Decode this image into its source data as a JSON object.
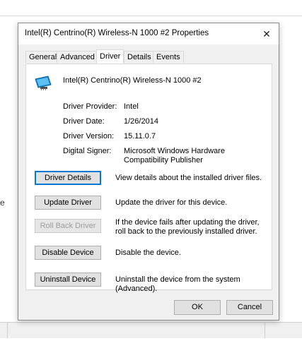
{
  "dialog": {
    "title": "Intel(R) Centrino(R) Wireless-N 1000 #2 Properties",
    "close_symbol": "✕"
  },
  "tabs": [
    {
      "label": "General"
    },
    {
      "label": "Advanced"
    },
    {
      "label": "Driver"
    },
    {
      "label": "Details"
    },
    {
      "label": "Events"
    }
  ],
  "active_tab": "Driver",
  "device": {
    "name": "Intel(R) Centrino(R) Wireless-N 1000 #2",
    "icon": "network-adapter-icon"
  },
  "properties": {
    "provider_label": "Driver Provider:",
    "provider_value": "Intel",
    "date_label": "Driver Date:",
    "date_value": "1/26/2014",
    "version_label": "Driver Version:",
    "version_value": "15.11.0.7",
    "signer_label": "Digital Signer:",
    "signer_value": "Microsoft Windows Hardware Compatibility Publisher"
  },
  "actions": [
    {
      "label": "Driver Details",
      "desc": "View details about the installed driver files."
    },
    {
      "label": "Update Driver",
      "desc": "Update the driver for this device."
    },
    {
      "label": "Roll Back Driver",
      "desc": "If the device fails after updating the driver, roll back to the previously installed driver."
    },
    {
      "label": "Disable Device",
      "desc": "Disable the device."
    },
    {
      "label": "Uninstall Device",
      "desc": "Uninstall the device from the system (Advanced)."
    }
  ],
  "footer": {
    "ok_label": "OK",
    "cancel_label": "Cancel"
  },
  "background": {
    "left_glyph": "e"
  }
}
